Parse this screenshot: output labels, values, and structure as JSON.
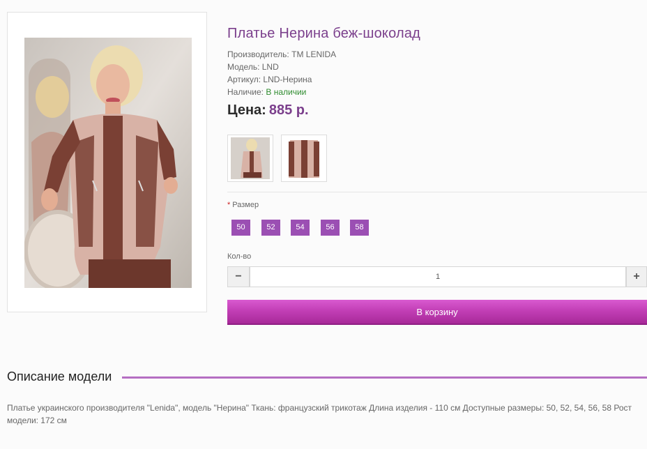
{
  "product": {
    "title": "Платье Нерина беж-шоколад",
    "manufacturer_label": "Производитель:",
    "manufacturer": "TM LENIDA",
    "model_label": "Модель:",
    "model": "LND",
    "sku_label": "Артикул:",
    "sku": "LND-Нерина",
    "availability_label": "Наличие:",
    "availability": "В наличии",
    "price_label": "Цена:",
    "price": "885 р."
  },
  "options": {
    "required_mark": "*",
    "size_label": "Размер",
    "sizes": [
      "50",
      "52",
      "54",
      "56",
      "58"
    ],
    "qty_label": "Кол-во",
    "qty_minus": "−",
    "qty_value": "1",
    "qty_plus": "+"
  },
  "cart": {
    "button_label": "В корзину"
  },
  "description": {
    "heading": "Описание модели",
    "text": "Платье украинского производителя \"Lenida\", модель \"Нерина\" Ткань: французский трикотаж Длина изделия - 110 см Доступные размеры: 50, 52, 54, 56, 58 Рост модели: 172 см"
  },
  "colors": {
    "accent": "#7b3f8c",
    "size_button": "#9b4fb3",
    "cart_button": "#c23fb6",
    "in_stock": "#2e8b2e",
    "dress_beige": "#d8b2a6",
    "dress_brown": "#7a4034"
  }
}
